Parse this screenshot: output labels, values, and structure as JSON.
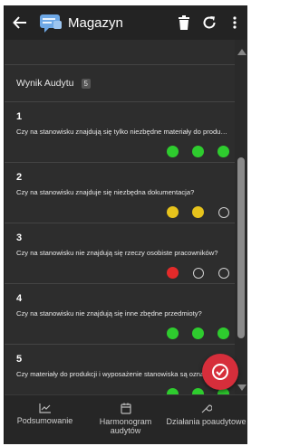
{
  "app_bar": {
    "title": "Magazyn"
  },
  "audit": {
    "title": "Wynik Audytu",
    "count": "5"
  },
  "questions": [
    {
      "number": "1",
      "text": "Czy na stanowisku znajdują się tylko niezbędne materiały do produkcji?",
      "dots": [
        "green",
        "green",
        "green"
      ]
    },
    {
      "number": "2",
      "text": "Czy na stanowisku znajduje się niezbędna dokumentacja?",
      "dots": [
        "yellow",
        "yellow",
        "empty"
      ]
    },
    {
      "number": "3",
      "text": "Czy na stanowisku nie znajdują się rzeczy osobiste pracowników?",
      "dots": [
        "red",
        "empty",
        "empty"
      ]
    },
    {
      "number": "4",
      "text": "Czy na stanowisku nie znajdują się inne zbędne przedmioty?",
      "dots": [
        "green",
        "green",
        "green"
      ]
    },
    {
      "number": "5",
      "text": "Czy materiały do produkcji i wyposażenie stanowiska są oznaczone?",
      "dots": [
        "green",
        "green",
        "green"
      ]
    }
  ],
  "bottom_nav": {
    "summary": "Podsumowanie",
    "schedule": "Harmonogram audytów",
    "actions": "Działania poaudytowe"
  },
  "colors": {
    "green": "#2ecc2e",
    "yellow": "#e6c31c",
    "red": "#e42a2a",
    "fab": "#d62e3b"
  }
}
